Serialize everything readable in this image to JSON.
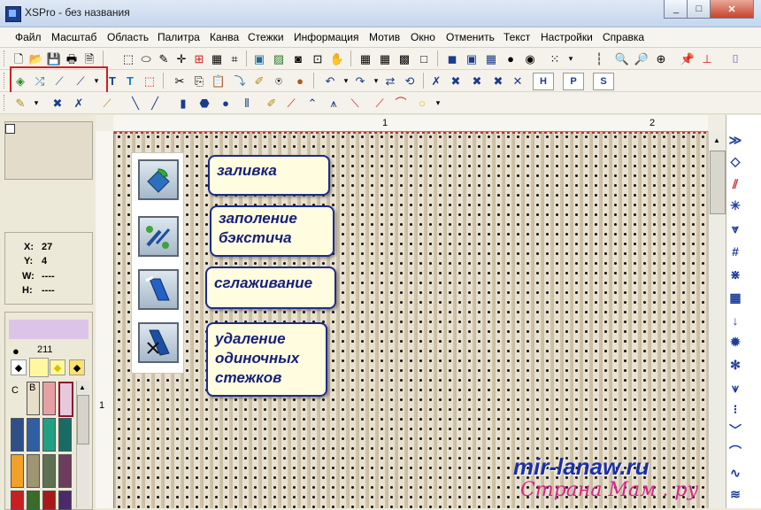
{
  "window": {
    "title": "XSPro - без названия"
  },
  "menu": [
    "Файл",
    "Масштаб",
    "Область",
    "Палитра",
    "Канва",
    "Стежки",
    "Информация",
    "Мотив",
    "Окно",
    "Отменить",
    "Текст",
    "Настройки",
    "Справка"
  ],
  "toolbar3": {
    "h_btn": "H",
    "p_btn": "P",
    "s_btn": "S"
  },
  "rulers": {
    "top_1": "1",
    "top_2": "2",
    "left_1": "1"
  },
  "info": {
    "x_label": "X:",
    "x_value": "27",
    "y_label": "Y:",
    "y_value": "4",
    "w_label": "W:",
    "w_value": "----",
    "h_label": "H:",
    "h_value": "----"
  },
  "palette": {
    "current_number": "211",
    "col_c": "C",
    "col_b": "B"
  },
  "callouts": {
    "fill": "заливка",
    "backstitch_fill": "заполение бэкстича",
    "smoothing": "сглаживание",
    "remove_single": "удаление одиночных стежков"
  },
  "watermarks": {
    "line1": "mir-lanaw.ru",
    "line2": "Страна Мам . ру"
  },
  "colors": {
    "highlight": "#d21f1f",
    "callout_border": "#1c2d8a",
    "callout_bg": "#fffce0",
    "selected_palette": "#e8c8dc",
    "watermark_blue": "#1d2fa6",
    "watermark_pink": "#d4278a"
  }
}
